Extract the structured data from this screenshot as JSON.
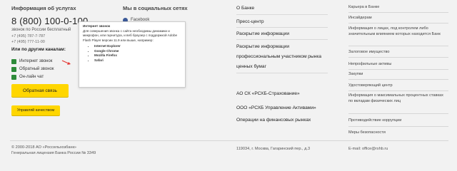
{
  "services": {
    "title": "Информация об услугах",
    "phone": "8 (800) 100-0-100",
    "phone_note": "звонок по России бесплатный",
    "phone2": "+7 (495) 787-7-787",
    "phone3": "+7 (495) 777-11-00",
    "channels_title": "Или по другим каналам:",
    "channels": [
      "Интернет звонок",
      "Обратный звонок",
      "Он-лайн чат"
    ],
    "callback_button": "Обратная связь",
    "quality_button": "Управляй качеством"
  },
  "social": {
    "title": "Мы в социальных сетях",
    "facebook": "Facebook"
  },
  "tooltip": {
    "title": "Интернет звонок",
    "text": "Для совершения звонка с сайта необходимы динамики и микрофон, или гарнитура, и веб браузер с поддержкой Adobe Flash Player версии 11.9 или выше, например:",
    "browsers": [
      "Internet Explorer",
      "Google Chrome",
      "Mozilla Firefox",
      "Safari"
    ]
  },
  "bank_col": {
    "about": "О Банке",
    "press": "Пресс-центр",
    "disclosure": "Раскрытие информации",
    "disclosure_pro": "Раскрытие информации профессиональным участником рынка ценных бумаг",
    "links": [
      "АО СК «РСХБ-Страхование»",
      "ООО «РСХБ Управление Активами»",
      "Операции на финансовых рынках"
    ]
  },
  "right_col": {
    "links": [
      "Карьера в Банке",
      "Инсайдерам",
      "Информация о лицах, под контролем либо значительным влиянием которых находится Банк",
      "Залоговое имущество",
      "Непрофильные активы",
      "Закупки",
      "Удостоверяющий центр",
      "Информация о максимальных процентных ставках по вкладам физических лиц",
      "Противодействие коррупции",
      "Меры безопасности"
    ]
  },
  "footer": {
    "copyright": "© 2000-2018 АО «Россельхозбанк»",
    "license": "Генеральная лицензия Банка России № 3349",
    "address": "119034, г. Москва, Гагаринский пер., д.3",
    "email": "E-mail: office@rshb.ru"
  },
  "colors": {
    "accent_yellow": "#ffd600",
    "green": "#2e8b3a"
  }
}
